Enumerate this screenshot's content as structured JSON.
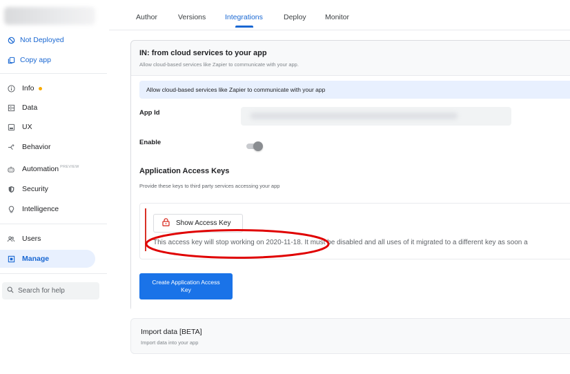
{
  "sidebar": {
    "status_label": "Not Deployed",
    "copy_label": "Copy app",
    "items": [
      {
        "label": "Info",
        "icon": "info-icon"
      },
      {
        "label": "Data",
        "icon": "data-icon"
      },
      {
        "label": "UX",
        "icon": "ux-icon"
      },
      {
        "label": "Behavior",
        "icon": "behavior-icon"
      },
      {
        "label": "Automation",
        "icon": "automation-icon",
        "badge": "PREVIEW"
      },
      {
        "label": "Security",
        "icon": "security-icon"
      },
      {
        "label": "Intelligence",
        "icon": "intelligence-icon"
      },
      {
        "label": "Users",
        "icon": "users-icon"
      },
      {
        "label": "Manage",
        "icon": "manage-icon",
        "active": true
      }
    ],
    "search_placeholder": "Search for help"
  },
  "tabs": [
    "Author",
    "Versions",
    "Integrations",
    "Deploy",
    "Monitor"
  ],
  "active_tab": "Integrations",
  "card": {
    "title": "IN: from cloud services to your app",
    "subtitle": "Allow cloud-based services like Zapier to communicate with your app.",
    "banner": "Allow cloud-based services like Zapier to communicate with your app",
    "app_id_label": "App Id",
    "enable_label": "Enable",
    "keys_heading": "Application Access Keys",
    "keys_sub": "Provide these keys to third party services accessing your app",
    "show_key_label": "Show Access Key",
    "key_warning": "This access key will stop working on 2020-11-18. It must be disabled and all uses of it migrated to a different key as soon a",
    "create_label": "Create Application Access Key"
  },
  "card2": {
    "title": "Import data [BETA]",
    "subtitle": "Import data into your app"
  },
  "colors": {
    "accent": "#1a73e8",
    "link": "#1967d2",
    "warning_bar": "#d93025",
    "annotation": "#e00000",
    "info_dot": "#f9ab00"
  }
}
